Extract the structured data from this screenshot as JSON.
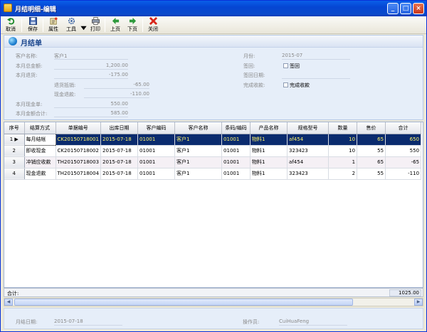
{
  "window": {
    "title": "月结明细-编辑",
    "minimize": "_",
    "maximize": "□",
    "close": "×"
  },
  "toolbar": {
    "cancel": "取消",
    "save": "保存",
    "properties": "属性",
    "tools": "工具",
    "print": "打印",
    "prev_page": "上页",
    "next_page": "下页",
    "close": "关闭"
  },
  "header": {
    "title": "月结单",
    "customer_name_label": "客户名称:",
    "customer_name": "客户1",
    "month_total_label": "本月总金额:",
    "month_total": "1,200.00",
    "month_return_label": "本月退货:",
    "month_return": "-175.00",
    "return_offset_label": "退货抵销:",
    "return_offset": "-65.00",
    "cash_refund_label": "现金退款:",
    "cash_refund": "-110.00",
    "month_cash_label": "本月现金单:",
    "month_cash": "550.00",
    "month_amount_total_label": "本月金额合计:",
    "month_amount_total": "585.00",
    "month_label": "月份:",
    "month": "2015-07",
    "signed_label": "签回:",
    "signed_cb": "签回",
    "sign_date_label": "签回日期:",
    "sign_date": "",
    "complete_label": "完成收款:",
    "complete_cb": "完成收款"
  },
  "table": {
    "columns": [
      "序号",
      "结算方式",
      "单据编号",
      "出库日期",
      "客户编码",
      "客户名称",
      "条码/编码",
      "产品名称",
      "规格型号",
      "数量",
      "售价",
      "合计"
    ],
    "rows": [
      {
        "no": "1",
        "settle": "每月结帐",
        "doc": "CK20150718001",
        "date": "2015-07-18",
        "cust_code": "01001",
        "cust_name": "客户1",
        "barcode": "01001",
        "product": "物料1",
        "spec": "af454",
        "qty": "10",
        "price": "65",
        "total": "650"
      },
      {
        "no": "2",
        "settle": "即收现金",
        "doc": "CK20150718002",
        "date": "2015-07-18",
        "cust_code": "01001",
        "cust_name": "客户1",
        "barcode": "01001",
        "product": "物料1",
        "spec": "323423",
        "qty": "10",
        "price": "55",
        "total": "550"
      },
      {
        "no": "3",
        "settle": "冲销应收款",
        "doc": "TH20150718003",
        "date": "2015-07-18",
        "cust_code": "01001",
        "cust_name": "客户1",
        "barcode": "01001",
        "product": "物料1",
        "spec": "af454",
        "qty": "1",
        "price": "65",
        "total": "-65"
      },
      {
        "no": "4",
        "settle": "现金退款",
        "doc": "TH20150718004",
        "date": "2015-07-18",
        "cust_code": "01001",
        "cust_name": "客户1",
        "barcode": "01001",
        "product": "物料1",
        "spec": "323423",
        "qty": "2",
        "price": "55",
        "total": "-110"
      }
    ]
  },
  "summary": {
    "label": "合计:",
    "total": "1025.00"
  },
  "footer": {
    "settle_date_label": "月结日期:",
    "settle_date": "2015-07-18",
    "operator_label": "操作员:",
    "operator": "CuiHuaFeng"
  },
  "colors": {
    "title_bar": "#0A5FE8",
    "selected_row": "#0A2B6E",
    "selected_text": "#FFF36A",
    "panel": "#E6EEF9"
  }
}
